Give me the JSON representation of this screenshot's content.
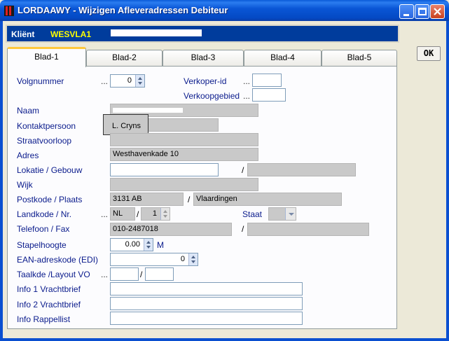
{
  "window": {
    "title": "LORDAAWY - Wijzigen Afleveradressen Debiteur",
    "buttons": {
      "minimize": "_",
      "maximize": "□",
      "close": "✕"
    }
  },
  "client": {
    "label": "Kliënt",
    "code": "WESVLA1"
  },
  "ok_label": "OK",
  "tabs": [
    {
      "label": "Blad-1",
      "active": true
    },
    {
      "label": "Blad-2"
    },
    {
      "label": "Blad-3"
    },
    {
      "label": "Blad-4"
    },
    {
      "label": "Blad-5"
    }
  ],
  "form": {
    "volgnummer": {
      "label": "Volgnummer",
      "dots": "...",
      "value": "0"
    },
    "verkoper_id": {
      "label": "Verkoper-id",
      "dots": "...",
      "value": ""
    },
    "verkoopgebied": {
      "label": "Verkoopgebied",
      "dots": "...",
      "value": ""
    },
    "naam": {
      "label": "Naam",
      "value": ""
    },
    "kontaktpersoon": {
      "label": "Kontaktpersoon",
      "value": "L. Cryns"
    },
    "straatvoorloop": {
      "label": "Straatvoorloop",
      "value": ""
    },
    "adres": {
      "label": "Adres",
      "value": "Westhavenkade 10"
    },
    "lokatie": {
      "label": "Lokatie / Gebouw",
      "value": "",
      "value2": ""
    },
    "wijk": {
      "label": "Wijk",
      "value": ""
    },
    "postkode": {
      "label": "Postkode / Plaats",
      "value": "3131 AB",
      "plaats": "Vlaardingen"
    },
    "landkode": {
      "label": "Landkode  / Nr.",
      "value": "NL",
      "nr": "1"
    },
    "staat": {
      "label": "Staat",
      "value": ""
    },
    "telefoon": {
      "label": "Telefoon / Fax",
      "value": "010-2487018",
      "fax": ""
    },
    "stapelhoogte": {
      "label": "Stapelhoogte",
      "value": "0.00",
      "unit": "M"
    },
    "ean": {
      "label": "EAN-adreskode (EDI)",
      "value": "0"
    },
    "taalkde": {
      "label": "Taalkde /Layout VO",
      "dots": "...",
      "value": "",
      "value2": ""
    },
    "info1": {
      "label": "Info 1 Vrachtbrief",
      "value": ""
    },
    "info2": {
      "label": "Info 2 Vrachtbrief",
      "value": ""
    },
    "info_rappel": {
      "label": "Info Rappellist",
      "value": ""
    }
  },
  "colors": {
    "title_bar": "#0a56d6",
    "client_bar": "#003c9c",
    "client_code": "#ffff00",
    "label_text": "#0a1b8c",
    "readonly_field": "#c9c9c9",
    "tab_highlight": "#ffc83c"
  }
}
